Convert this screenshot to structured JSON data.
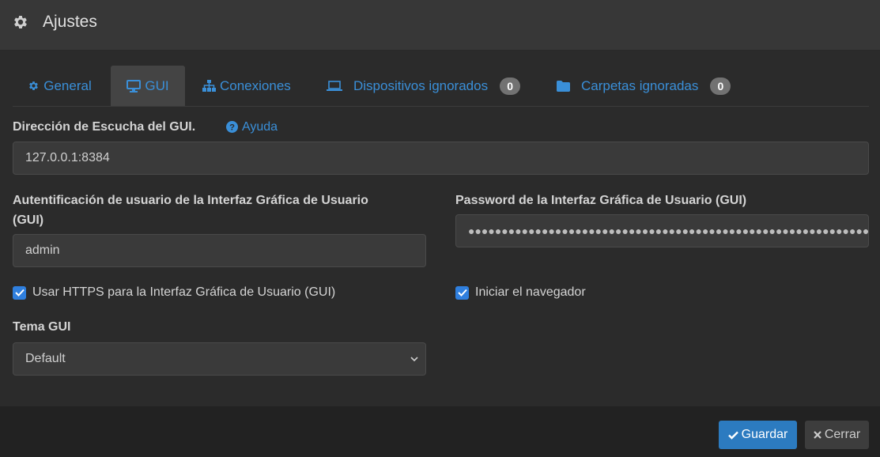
{
  "header": {
    "title": "Ajustes",
    "icon": "gear-icon"
  },
  "tabs": [
    {
      "label": "General",
      "icon": "cog-icon",
      "active": false
    },
    {
      "label": "GUI",
      "icon": "desktop-icon",
      "active": true
    },
    {
      "label": "Conexiones",
      "icon": "sitemap-icon",
      "active": false
    },
    {
      "label": "Dispositivos ignorados",
      "icon": "laptop-icon",
      "badge": "0",
      "active": false
    },
    {
      "label": "Carpetas ignoradas",
      "icon": "folder-icon",
      "badge": "0",
      "active": false
    }
  ],
  "listen_address": {
    "label": "Dirección de Escucha del GUI.",
    "help_label": "Ayuda",
    "value": "127.0.0.1:8384"
  },
  "auth_user": {
    "label_line1": "Autentificación de usuario de la Interfaz Gráfica de Usuario",
    "label_line2": "(GUI)",
    "value": "admin"
  },
  "auth_password": {
    "label": "Password de la Interfaz Gráfica de Usuario (GUI)",
    "value": "●●●●●●●●●●●●●●●●●●●●●●●●●●●●●●●●●●●●●●●●●●●●●●●●●●●●●●●●●●●●●●"
  },
  "use_https": {
    "label": "Usar HTTPS para la Interfaz Gráfica de Usuario (GUI)",
    "checked": true
  },
  "start_browser": {
    "label": "Iniciar el navegador",
    "checked": true
  },
  "theme": {
    "label": "Tema GUI",
    "selected": "Default"
  },
  "footer": {
    "save_label": "Guardar",
    "close_label": "Cerrar"
  },
  "colors": {
    "accent": "#3a8fd8",
    "primary_button": "#2c7bc0",
    "checkbox": "#2f7fde"
  }
}
